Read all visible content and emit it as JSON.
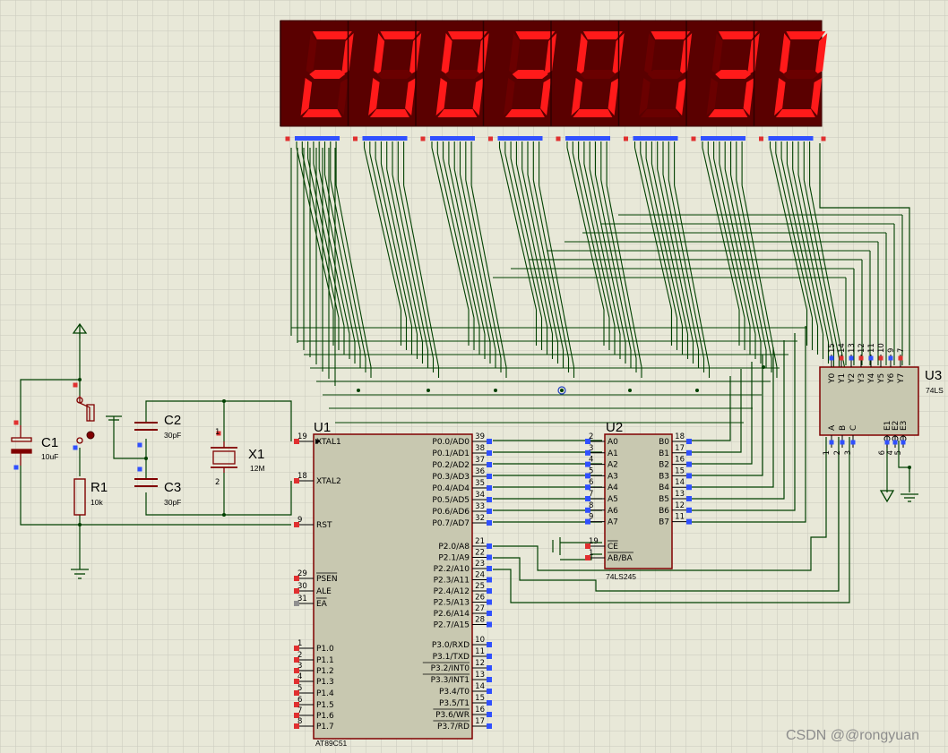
{
  "display": {
    "digits": [
      "2",
      "0",
      "0",
      "3",
      "0",
      "7",
      "3",
      "0"
    ],
    "segment_on_color": "#ff1a1a",
    "segment_off_color": "#6a0000",
    "body_color": "#5a0000"
  },
  "u1": {
    "ref": "U1",
    "part": "AT89C51",
    "left_pins": [
      {
        "num": "19",
        "label": "XTAL1"
      },
      {
        "num": "18",
        "label": "XTAL2"
      },
      {
        "num": "9",
        "label": "RST"
      },
      {
        "num": "29",
        "label": "PSEN"
      },
      {
        "num": "30",
        "label": "ALE"
      },
      {
        "num": "31",
        "label": "EA"
      },
      {
        "num": "1",
        "label": "P1.0"
      },
      {
        "num": "2",
        "label": "P1.1"
      },
      {
        "num": "3",
        "label": "P1.2"
      },
      {
        "num": "4",
        "label": "P1.3"
      },
      {
        "num": "5",
        "label": "P1.4"
      },
      {
        "num": "6",
        "label": "P1.5"
      },
      {
        "num": "7",
        "label": "P1.6"
      },
      {
        "num": "8",
        "label": "P1.7"
      }
    ],
    "right_pins": [
      {
        "num": "39",
        "label": "P0.0/AD0"
      },
      {
        "num": "38",
        "label": "P0.1/AD1"
      },
      {
        "num": "37",
        "label": "P0.2/AD2"
      },
      {
        "num": "36",
        "label": "P0.3/AD3"
      },
      {
        "num": "35",
        "label": "P0.4/AD4"
      },
      {
        "num": "34",
        "label": "P0.5/AD5"
      },
      {
        "num": "33",
        "label": "P0.6/AD6"
      },
      {
        "num": "32",
        "label": "P0.7/AD7"
      },
      {
        "num": "21",
        "label": "P2.0/A8"
      },
      {
        "num": "22",
        "label": "P2.1/A9"
      },
      {
        "num": "23",
        "label": "P2.2/A10"
      },
      {
        "num": "24",
        "label": "P2.3/A11"
      },
      {
        "num": "25",
        "label": "P2.4/A12"
      },
      {
        "num": "26",
        "label": "P2.5/A13"
      },
      {
        "num": "27",
        "label": "P2.6/A14"
      },
      {
        "num": "28",
        "label": "P2.7/A15"
      },
      {
        "num": "10",
        "label": "P3.0/RXD"
      },
      {
        "num": "11",
        "label": "P3.1/TXD"
      },
      {
        "num": "12",
        "label": "P3.2/INT0"
      },
      {
        "num": "13",
        "label": "P3.3/INT1"
      },
      {
        "num": "14",
        "label": "P3.4/T0"
      },
      {
        "num": "15",
        "label": "P3.5/T1"
      },
      {
        "num": "16",
        "label": "P3.6/WR"
      },
      {
        "num": "17",
        "label": "P3.7/RD"
      }
    ]
  },
  "u2": {
    "ref": "U2",
    "part": "74LS245",
    "a_pins": [
      {
        "num": "2",
        "label": "A0"
      },
      {
        "num": "3",
        "label": "A1"
      },
      {
        "num": "4",
        "label": "A2"
      },
      {
        "num": "5",
        "label": "A3"
      },
      {
        "num": "6",
        "label": "A4"
      },
      {
        "num": "7",
        "label": "A5"
      },
      {
        "num": "8",
        "label": "A6"
      },
      {
        "num": "9",
        "label": "A7"
      }
    ],
    "b_pins": [
      {
        "num": "18",
        "label": "B0"
      },
      {
        "num": "17",
        "label": "B1"
      },
      {
        "num": "16",
        "label": "B2"
      },
      {
        "num": "15",
        "label": "B3"
      },
      {
        "num": "14",
        "label": "B4"
      },
      {
        "num": "13",
        "label": "B5"
      },
      {
        "num": "12",
        "label": "B6"
      },
      {
        "num": "11",
        "label": "B7"
      }
    ],
    "ctrl_pins": [
      {
        "num": "19",
        "label": "CE"
      },
      {
        "num": "1",
        "label": "AB/BA"
      }
    ]
  },
  "u3": {
    "ref": "U3",
    "part": "74LS",
    "y_pins": [
      {
        "num": "15",
        "label": "Y0"
      },
      {
        "num": "14",
        "label": "Y1"
      },
      {
        "num": "13",
        "label": "Y2"
      },
      {
        "num": "12",
        "label": "Y3"
      },
      {
        "num": "11",
        "label": "Y4"
      },
      {
        "num": "10",
        "label": "Y5"
      },
      {
        "num": "9",
        "label": "Y6"
      },
      {
        "num": "7",
        "label": "Y7"
      }
    ],
    "in_pins": [
      {
        "num": "1",
        "label": "A"
      },
      {
        "num": "2",
        "label": "B"
      },
      {
        "num": "3",
        "label": "C"
      },
      {
        "num": "6",
        "label": "E1"
      },
      {
        "num": "4",
        "label": "E2"
      },
      {
        "num": "5",
        "label": "E3"
      }
    ]
  },
  "parts": {
    "c1": {
      "ref": "C1",
      "value": "10uF"
    },
    "r1": {
      "ref": "R1",
      "value": "10k"
    },
    "c2": {
      "ref": "C2",
      "value": "30pF"
    },
    "c3": {
      "ref": "C3",
      "value": "30pF"
    },
    "x1": {
      "ref": "X1",
      "value": "12M",
      "pin1": "1",
      "pin2": "2"
    }
  },
  "watermark": "CSDN @@rongyuan",
  "colors": {
    "background": "#e8e8d8",
    "grid": "#c9c9bd",
    "wire": "#004000",
    "component": "#800000",
    "chip_fill": "#c8c8b0",
    "pin_red": "#e03030",
    "pin_blue": "#3050ff"
  }
}
